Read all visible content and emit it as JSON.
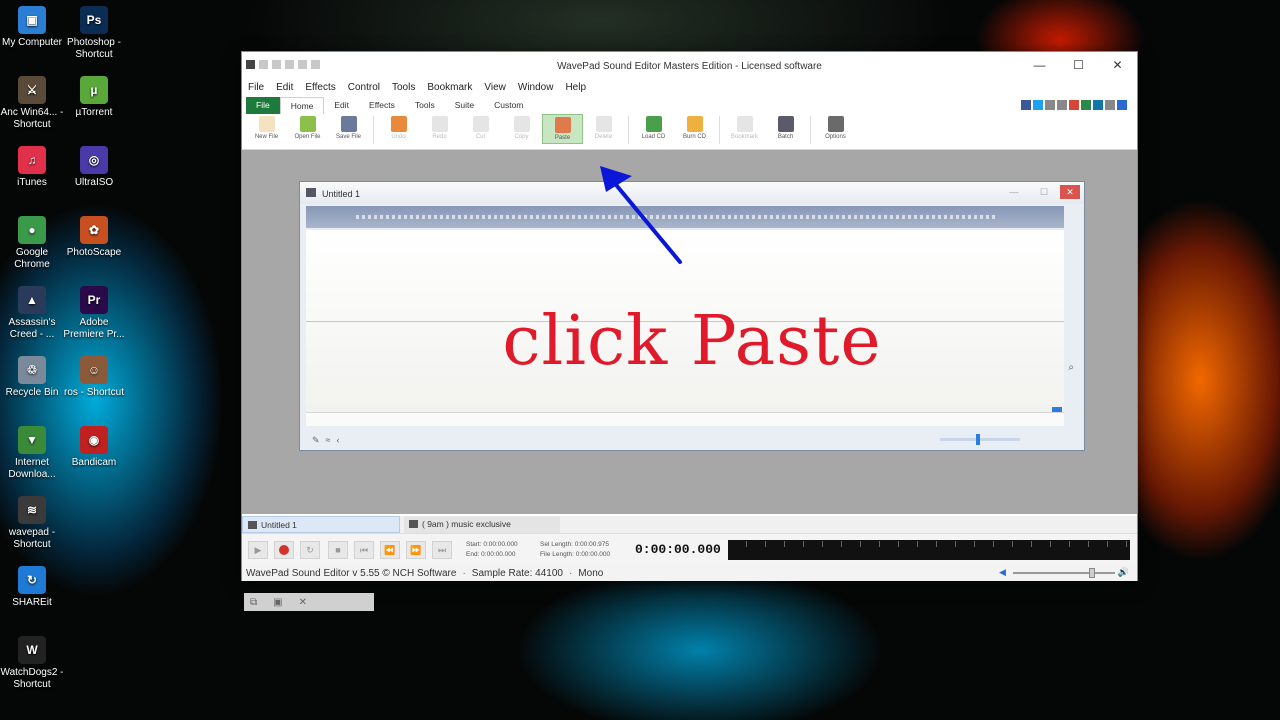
{
  "desktop": {
    "icons": [
      {
        "label": "My Computer",
        "glyph": "▣",
        "color": "#2a7fd4"
      },
      {
        "label": "Photoshop - Shortcut",
        "glyph": "Ps",
        "color": "#0b2d54"
      },
      {
        "label": "Anc Win64... - Shortcut",
        "glyph": "⚔",
        "color": "#5a4a3a"
      },
      {
        "label": "µTorrent",
        "glyph": "µ",
        "color": "#5aa83a"
      },
      {
        "label": "iTunes",
        "glyph": "♫",
        "color": "#e0304a"
      },
      {
        "label": "UltraISO",
        "glyph": "◎",
        "color": "#4a3aa8"
      },
      {
        "label": "Google Chrome",
        "glyph": "●",
        "color": "#3a9a4a"
      },
      {
        "label": "PhotoScape",
        "glyph": "✿",
        "color": "#c85020"
      },
      {
        "label": "Assassin's Creed - ...",
        "glyph": "▲",
        "color": "#2a3a5a"
      },
      {
        "label": "Adobe Premiere Pr...",
        "glyph": "Pr",
        "color": "#2a0a4a"
      },
      {
        "label": "Recycle Bin",
        "glyph": "♲",
        "color": "#7a8a9a"
      },
      {
        "label": "ros - Shortcut",
        "glyph": "☺",
        "color": "#8a5a3a"
      },
      {
        "label": "Internet Downloa...",
        "glyph": "▼",
        "color": "#3a8a3a"
      },
      {
        "label": "Bandicam",
        "glyph": "◉",
        "color": "#c02020"
      },
      {
        "label": "wavepad - Shortcut",
        "glyph": "≋",
        "color": "#3a3a3a"
      },
      {
        "label": "SHAREit",
        "glyph": "↻",
        "color": "#1e7ad4"
      },
      {
        "label": "WatchDogs2 - Shortcut",
        "glyph": "W",
        "color": "#222222"
      }
    ]
  },
  "window": {
    "title": "WavePad Sound Editor Masters Edition - Licensed software",
    "controls": {
      "minimize": "—",
      "maximize": "☐",
      "close": "✕"
    },
    "menu": [
      "File",
      "Edit",
      "Effects",
      "Control",
      "Tools",
      "Bookmark",
      "View",
      "Window",
      "Help"
    ],
    "ribbon_tabs": [
      "File",
      "Home",
      "Edit",
      "Effects",
      "Tools",
      "Suite",
      "Custom"
    ],
    "active_ribbon_tab": "Home",
    "ribbon_buttons": [
      {
        "label": "New File",
        "color": "#f3e3c0"
      },
      {
        "label": "Open File",
        "color": "#8cc04a"
      },
      {
        "label": "Save File",
        "color": "#6a7a9a"
      },
      {
        "label": "Undo",
        "color": "#e88a3a"
      },
      {
        "label": "Redo",
        "color": "#e5e5e5"
      },
      {
        "label": "Cut",
        "color": "#e5e5e5"
      },
      {
        "label": "Copy",
        "color": "#e5e5e5"
      },
      {
        "label": "Paste",
        "color": "#e07a4a"
      },
      {
        "label": "Delete",
        "color": "#e5e5e5"
      },
      {
        "label": "Load CD",
        "color": "#4aa04a"
      },
      {
        "label": "Burn CD",
        "color": "#f0b040"
      },
      {
        "label": "Bookmark",
        "color": "#e5e5e5"
      },
      {
        "label": "Batch",
        "color": "#5a5a6a"
      },
      {
        "label": "Options",
        "color": "#6a6a6a"
      }
    ],
    "social_colors": [
      "#3b5998",
      "#1da1f2",
      "#888888",
      "#888888",
      "#d44638",
      "#2a8a4a",
      "#0e76a8",
      "#888888",
      "#2a6ad3"
    ]
  },
  "document": {
    "title": "Untitled 1",
    "controls": {
      "minimize": "—",
      "maximize": "☐",
      "close": "✕"
    },
    "overlay_text": "click Paste",
    "zoom_icon": "⌕"
  },
  "file_tabs": [
    {
      "label": "Untitled 1",
      "active": true
    },
    {
      "label": "( 9am ) music exclusive",
      "active": false
    }
  ],
  "transport": {
    "start": "Start: 0:00:00.000",
    "end": "End: 0:00:00.000",
    "sel_length": "Sel Length: 0:00:00.975",
    "file_length": "File Length: 0:00:00.000",
    "clock": "0:00:00.000"
  },
  "status": {
    "version": "WavePad Sound Editor v 5.55 © NCH Software",
    "sample_rate": "Sample Rate: 44100",
    "channels": "Mono"
  },
  "annotation": {
    "arrow_color": "#0a16d8",
    "text_color": "#e01a2a"
  }
}
